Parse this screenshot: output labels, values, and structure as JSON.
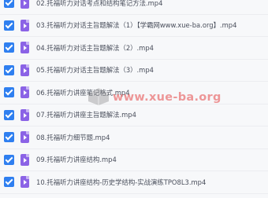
{
  "files": [
    {
      "name": "02.托福听力对话考点和结构笔记方法.mp4"
    },
    {
      "name": "03.托福听力对话主旨题解法（1）【学霸网www.xue-ba.org】.mp4"
    },
    {
      "name": "04.托福听力对话主旨题解法（2）.mp4"
    },
    {
      "name": "05.托福听力对话主旨题解法（3）.mp4"
    },
    {
      "name": "06.托福听力讲座笔记格式.mp4"
    },
    {
      "name": "07.托福听力讲座主旨题解法.mp4"
    },
    {
      "name": "08.托福听力细节题.mp4"
    },
    {
      "name": "09.托福听力讲座结构.mp4"
    },
    {
      "name": "10.托福听力讲座结构-历史学结构-实战演练TPO8L3.mp4"
    }
  ],
  "watermark": {
    "text": "www.xue-ba.org"
  },
  "colors": {
    "checkbox": "#2f7ff0",
    "file_icon": "#8b63e6"
  }
}
